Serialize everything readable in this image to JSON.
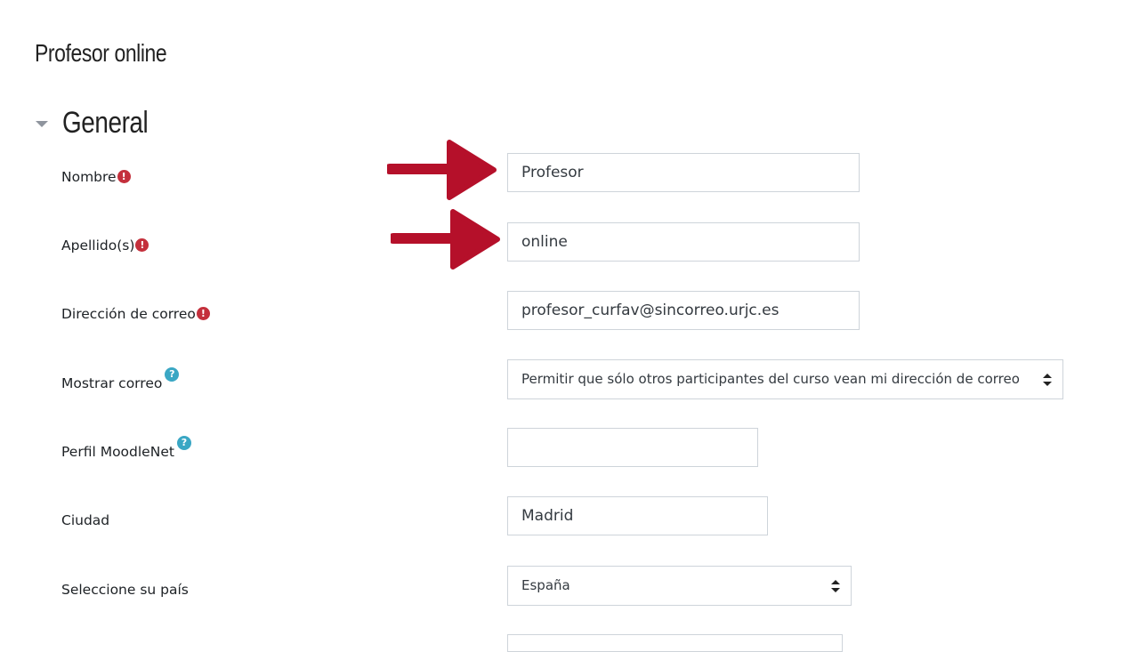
{
  "page": {
    "title": "Profesor online"
  },
  "section": {
    "title": "General",
    "toggle_icon": "caret-down-icon"
  },
  "fields": {
    "nombre": {
      "label": "Nombre",
      "value": "Profesor",
      "required": true
    },
    "apellidos": {
      "label": "Apellido(s)",
      "value": "online",
      "required": true
    },
    "correo": {
      "label": "Dirección de correo",
      "value": "profesor_curfav@sincorreo.urjc.es",
      "required": true
    },
    "mostrar_correo": {
      "label": "Mostrar correo",
      "selected": "Permitir que sólo otros participantes del curso vean mi dirección de correo",
      "help": true
    },
    "moodlenet": {
      "label": "Perfil MoodleNet",
      "value": "",
      "help": true
    },
    "ciudad": {
      "label": "Ciudad",
      "value": "Madrid"
    },
    "pais": {
      "label": "Seleccione su país",
      "selected": "España"
    }
  },
  "icons": {
    "required": {
      "glyph": "!",
      "color": "#c4303c"
    },
    "help": {
      "glyph": "?",
      "color": "#3aa7c4"
    }
  },
  "annotations": {
    "arrow_color": "#b5102a"
  }
}
